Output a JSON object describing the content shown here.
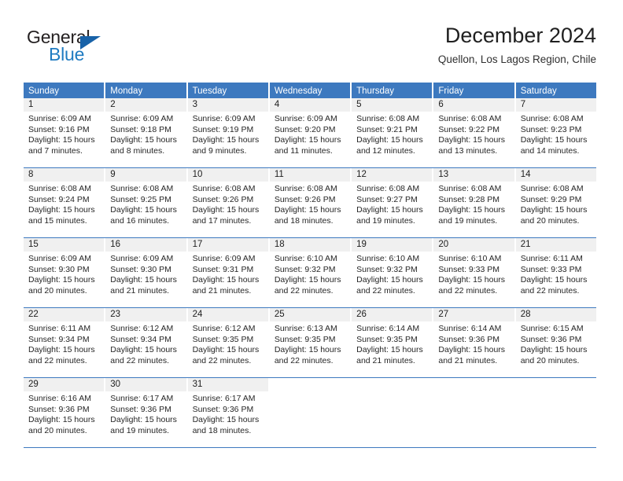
{
  "brand": {
    "word_one": "General",
    "word_two": "Blue",
    "logo_icon": "triangle-logo-icon",
    "accent_color": "#1f7bc1"
  },
  "header": {
    "month_title": "December 2024",
    "location": "Quellon, Los Lagos Region, Chile"
  },
  "theme": {
    "header_bar_color": "#3d79bf",
    "day_number_bg": "#f0f0f0",
    "text_color": "#262626"
  },
  "calendar": {
    "weekdays": [
      "Sunday",
      "Monday",
      "Tuesday",
      "Wednesday",
      "Thursday",
      "Friday",
      "Saturday"
    ],
    "weeks": [
      [
        {
          "day": "1",
          "sunrise": "Sunrise: 6:09 AM",
          "sunset": "Sunset: 9:16 PM",
          "daylight": "Daylight: 15 hours and 7 minutes."
        },
        {
          "day": "2",
          "sunrise": "Sunrise: 6:09 AM",
          "sunset": "Sunset: 9:18 PM",
          "daylight": "Daylight: 15 hours and 8 minutes."
        },
        {
          "day": "3",
          "sunrise": "Sunrise: 6:09 AM",
          "sunset": "Sunset: 9:19 PM",
          "daylight": "Daylight: 15 hours and 9 minutes."
        },
        {
          "day": "4",
          "sunrise": "Sunrise: 6:09 AM",
          "sunset": "Sunset: 9:20 PM",
          "daylight": "Daylight: 15 hours and 11 minutes."
        },
        {
          "day": "5",
          "sunrise": "Sunrise: 6:08 AM",
          "sunset": "Sunset: 9:21 PM",
          "daylight": "Daylight: 15 hours and 12 minutes."
        },
        {
          "day": "6",
          "sunrise": "Sunrise: 6:08 AM",
          "sunset": "Sunset: 9:22 PM",
          "daylight": "Daylight: 15 hours and 13 minutes."
        },
        {
          "day": "7",
          "sunrise": "Sunrise: 6:08 AM",
          "sunset": "Sunset: 9:23 PM",
          "daylight": "Daylight: 15 hours and 14 minutes."
        }
      ],
      [
        {
          "day": "8",
          "sunrise": "Sunrise: 6:08 AM",
          "sunset": "Sunset: 9:24 PM",
          "daylight": "Daylight: 15 hours and 15 minutes."
        },
        {
          "day": "9",
          "sunrise": "Sunrise: 6:08 AM",
          "sunset": "Sunset: 9:25 PM",
          "daylight": "Daylight: 15 hours and 16 minutes."
        },
        {
          "day": "10",
          "sunrise": "Sunrise: 6:08 AM",
          "sunset": "Sunset: 9:26 PM",
          "daylight": "Daylight: 15 hours and 17 minutes."
        },
        {
          "day": "11",
          "sunrise": "Sunrise: 6:08 AM",
          "sunset": "Sunset: 9:26 PM",
          "daylight": "Daylight: 15 hours and 18 minutes."
        },
        {
          "day": "12",
          "sunrise": "Sunrise: 6:08 AM",
          "sunset": "Sunset: 9:27 PM",
          "daylight": "Daylight: 15 hours and 19 minutes."
        },
        {
          "day": "13",
          "sunrise": "Sunrise: 6:08 AM",
          "sunset": "Sunset: 9:28 PM",
          "daylight": "Daylight: 15 hours and 19 minutes."
        },
        {
          "day": "14",
          "sunrise": "Sunrise: 6:08 AM",
          "sunset": "Sunset: 9:29 PM",
          "daylight": "Daylight: 15 hours and 20 minutes."
        }
      ],
      [
        {
          "day": "15",
          "sunrise": "Sunrise: 6:09 AM",
          "sunset": "Sunset: 9:30 PM",
          "daylight": "Daylight: 15 hours and 20 minutes."
        },
        {
          "day": "16",
          "sunrise": "Sunrise: 6:09 AM",
          "sunset": "Sunset: 9:30 PM",
          "daylight": "Daylight: 15 hours and 21 minutes."
        },
        {
          "day": "17",
          "sunrise": "Sunrise: 6:09 AM",
          "sunset": "Sunset: 9:31 PM",
          "daylight": "Daylight: 15 hours and 21 minutes."
        },
        {
          "day": "18",
          "sunrise": "Sunrise: 6:10 AM",
          "sunset": "Sunset: 9:32 PM",
          "daylight": "Daylight: 15 hours and 22 minutes."
        },
        {
          "day": "19",
          "sunrise": "Sunrise: 6:10 AM",
          "sunset": "Sunset: 9:32 PM",
          "daylight": "Daylight: 15 hours and 22 minutes."
        },
        {
          "day": "20",
          "sunrise": "Sunrise: 6:10 AM",
          "sunset": "Sunset: 9:33 PM",
          "daylight": "Daylight: 15 hours and 22 minutes."
        },
        {
          "day": "21",
          "sunrise": "Sunrise: 6:11 AM",
          "sunset": "Sunset: 9:33 PM",
          "daylight": "Daylight: 15 hours and 22 minutes."
        }
      ],
      [
        {
          "day": "22",
          "sunrise": "Sunrise: 6:11 AM",
          "sunset": "Sunset: 9:34 PM",
          "daylight": "Daylight: 15 hours and 22 minutes."
        },
        {
          "day": "23",
          "sunrise": "Sunrise: 6:12 AM",
          "sunset": "Sunset: 9:34 PM",
          "daylight": "Daylight: 15 hours and 22 minutes."
        },
        {
          "day": "24",
          "sunrise": "Sunrise: 6:12 AM",
          "sunset": "Sunset: 9:35 PM",
          "daylight": "Daylight: 15 hours and 22 minutes."
        },
        {
          "day": "25",
          "sunrise": "Sunrise: 6:13 AM",
          "sunset": "Sunset: 9:35 PM",
          "daylight": "Daylight: 15 hours and 22 minutes."
        },
        {
          "day": "26",
          "sunrise": "Sunrise: 6:14 AM",
          "sunset": "Sunset: 9:35 PM",
          "daylight": "Daylight: 15 hours and 21 minutes."
        },
        {
          "day": "27",
          "sunrise": "Sunrise: 6:14 AM",
          "sunset": "Sunset: 9:36 PM",
          "daylight": "Daylight: 15 hours and 21 minutes."
        },
        {
          "day": "28",
          "sunrise": "Sunrise: 6:15 AM",
          "sunset": "Sunset: 9:36 PM",
          "daylight": "Daylight: 15 hours and 20 minutes."
        }
      ],
      [
        {
          "day": "29",
          "sunrise": "Sunrise: 6:16 AM",
          "sunset": "Sunset: 9:36 PM",
          "daylight": "Daylight: 15 hours and 20 minutes."
        },
        {
          "day": "30",
          "sunrise": "Sunrise: 6:17 AM",
          "sunset": "Sunset: 9:36 PM",
          "daylight": "Daylight: 15 hours and 19 minutes."
        },
        {
          "day": "31",
          "sunrise": "Sunrise: 6:17 AM",
          "sunset": "Sunset: 9:36 PM",
          "daylight": "Daylight: 15 hours and 18 minutes."
        },
        {
          "day": "",
          "sunrise": "",
          "sunset": "",
          "daylight": ""
        },
        {
          "day": "",
          "sunrise": "",
          "sunset": "",
          "daylight": ""
        },
        {
          "day": "",
          "sunrise": "",
          "sunset": "",
          "daylight": ""
        },
        {
          "day": "",
          "sunrise": "",
          "sunset": "",
          "daylight": ""
        }
      ]
    ]
  }
}
